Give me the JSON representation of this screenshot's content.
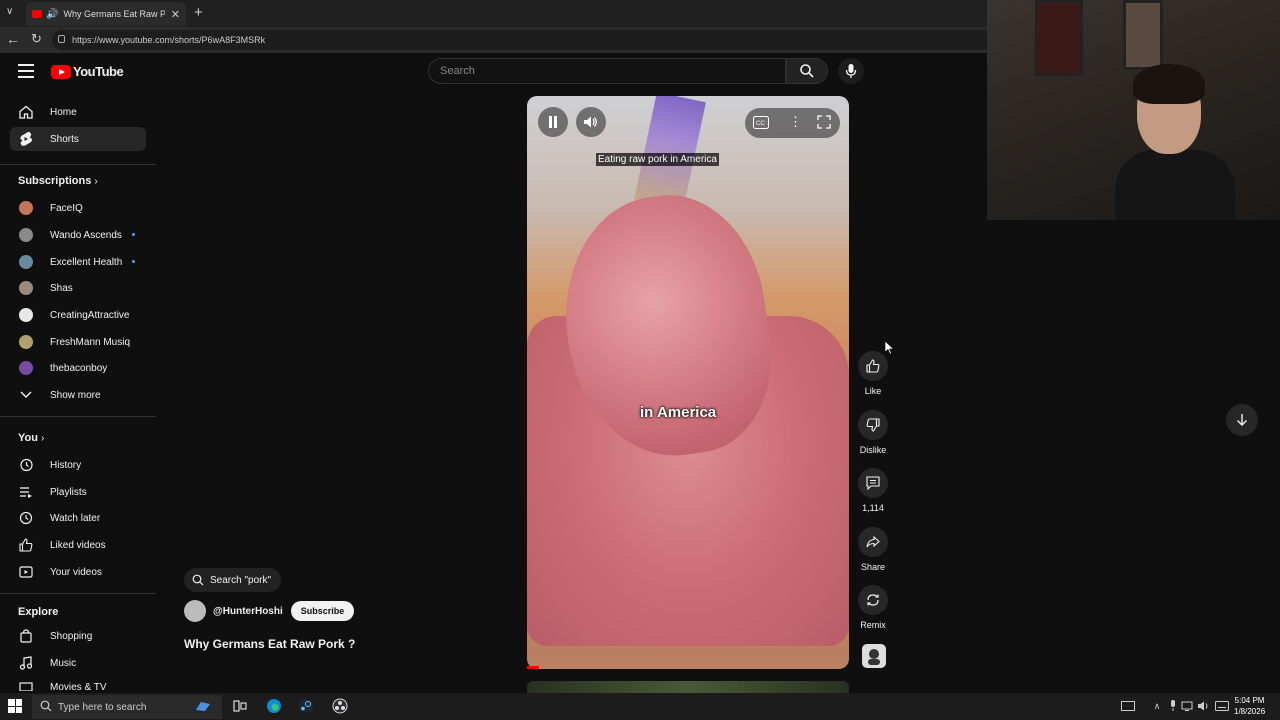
{
  "browser": {
    "tab_title": "Why Germans Eat Raw Pork ?",
    "url": "https://www.youtube.com/shorts/P6wA8F3MSRk"
  },
  "header": {
    "logo_text": "YouTube",
    "search_placeholder": "Search"
  },
  "sidebar": {
    "main": [
      {
        "label": "Home",
        "icon": "home-icon"
      },
      {
        "label": "Shorts",
        "icon": "shorts-icon",
        "active": true
      }
    ],
    "subscriptions_title": "Subscriptions",
    "subscriptions": [
      {
        "label": "FaceIQ",
        "color": "#c8745a"
      },
      {
        "label": "Wando Ascends",
        "color": "#8a8a8a",
        "new": true
      },
      {
        "label": "Excellent Health",
        "color": "#6a8aa0",
        "new": true
      },
      {
        "label": "Shas",
        "color": "#9a8a7a"
      },
      {
        "label": "CreatingAttractive",
        "color": "#e8e8e8"
      },
      {
        "label": "FreshMann Musiq",
        "color": "#b0a070"
      },
      {
        "label": "thebaconboy",
        "color": "#7a4aa0"
      }
    ],
    "show_more": "Show more",
    "you_title": "You",
    "you_items": [
      {
        "label": "History",
        "icon": "history-icon"
      },
      {
        "label": "Playlists",
        "icon": "playlists-icon"
      },
      {
        "label": "Watch later",
        "icon": "watch-later-icon"
      },
      {
        "label": "Liked videos",
        "icon": "like-icon"
      },
      {
        "label": "Your videos",
        "icon": "your-videos-icon"
      }
    ],
    "explore_title": "Explore",
    "explore_items": [
      {
        "label": "Shopping",
        "icon": "shopping-icon"
      },
      {
        "label": "Music",
        "icon": "music-icon"
      },
      {
        "label": "Movies & TV",
        "icon": "movies-icon"
      }
    ]
  },
  "video": {
    "caption_top": "Eating raw pork in America",
    "caption_mid": "in America"
  },
  "actions": {
    "like": "Like",
    "dislike": "Dislike",
    "comments": "1,114",
    "share": "Share",
    "remix": "Remix"
  },
  "info": {
    "search_chip": "Search \"pork\"",
    "channel": "@HunterHoshi",
    "subscribe": "Subscribe",
    "title": "Why Germans Eat Raw Pork ?"
  },
  "taskbar": {
    "search_placeholder": "Type here to search",
    "time": "5:04 PM",
    "date": "1/8/2026"
  }
}
